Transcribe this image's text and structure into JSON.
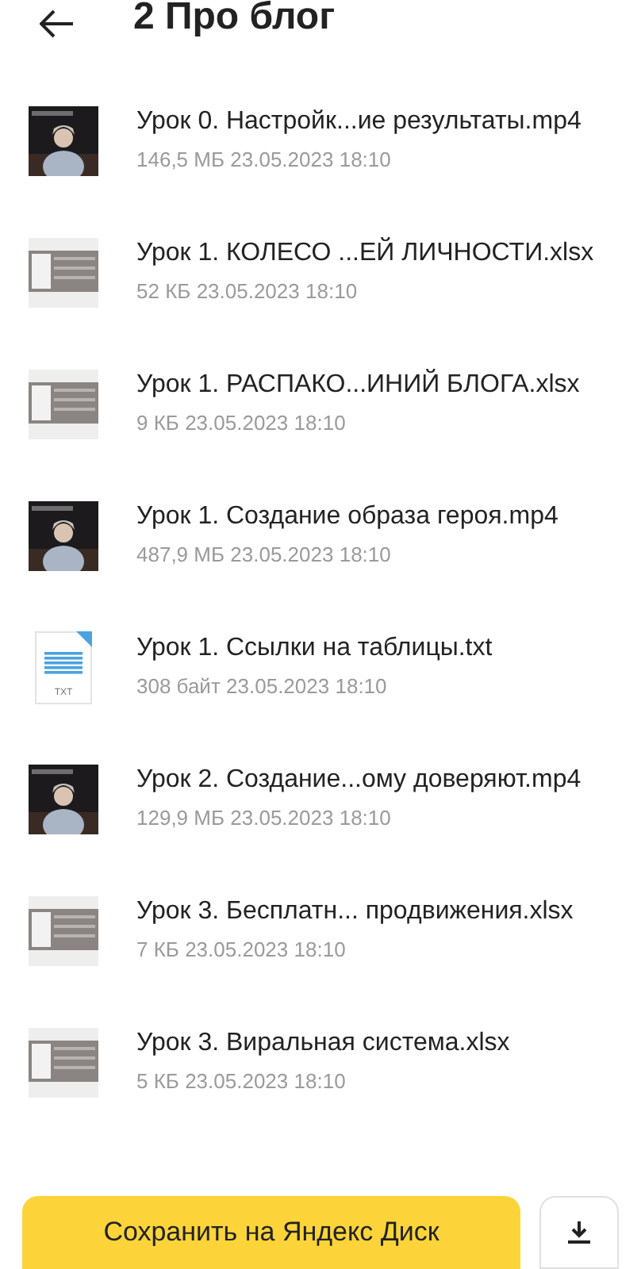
{
  "header": {
    "title": "2 Про блог"
  },
  "files": [
    {
      "name": "Урок 0. Настройк...ие результаты.mp4",
      "size": "146,5 МБ",
      "date": "23.05.2023",
      "time": "18:10",
      "kind": "video"
    },
    {
      "name": "Урок 1. КОЛЕСО ...ЕЙ ЛИЧНОСТИ.xlsx",
      "size": "52 КБ",
      "date": "23.05.2023",
      "time": "18:10",
      "kind": "sheet"
    },
    {
      "name": "Урок 1. РАСПАКО...ИНИЙ БЛОГА.xlsx",
      "size": "9 КБ",
      "date": "23.05.2023",
      "time": "18:10",
      "kind": "sheet"
    },
    {
      "name": "Урок 1. Создание образа героя.mp4",
      "size": "487,9 МБ",
      "date": "23.05.2023",
      "time": "18:10",
      "kind": "video"
    },
    {
      "name": "Урок 1. Ссылки на таблицы.txt",
      "size": "308 байт",
      "date": "23.05.2023",
      "time": "18:10",
      "kind": "txt",
      "icon_label": "TXT"
    },
    {
      "name": "Урок 2. Создание...ому доверяют.mp4",
      "size": "129,9 МБ",
      "date": "23.05.2023",
      "time": "18:10",
      "kind": "video"
    },
    {
      "name": "Урок 3. Бесплатн... продвижения.xlsx",
      "size": "7 КБ",
      "date": "23.05.2023",
      "time": "18:10",
      "kind": "sheet"
    },
    {
      "name": "Урок 3. Виральная система.xlsx",
      "size": "5 КБ",
      "date": "23.05.2023",
      "time": "18:10",
      "kind": "sheet"
    }
  ],
  "save_button": {
    "label": "Сохранить на Яндекс Диск"
  }
}
